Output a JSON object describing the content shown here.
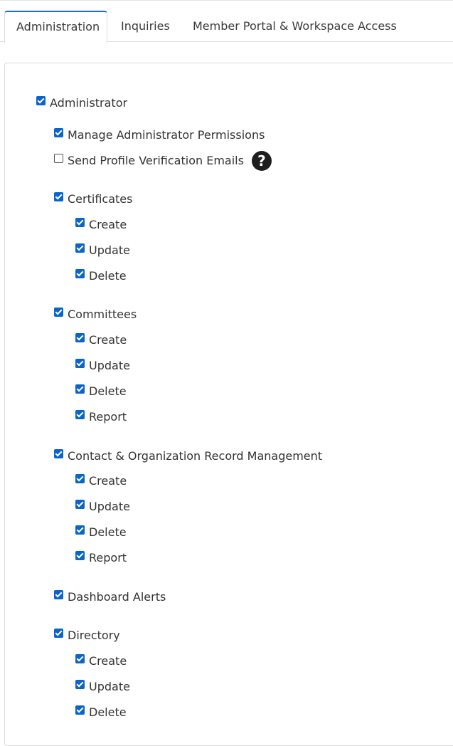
{
  "tabs": [
    {
      "label": "Administration"
    },
    {
      "label": "Inquiries"
    },
    {
      "label": "Member Portal & Workspace Access"
    }
  ],
  "permissions": [
    {
      "label": "Administrator",
      "checked": true
    },
    {
      "label": "Manage Administrator Permissions",
      "checked": true
    },
    {
      "label": "Send Profile Verification Emails",
      "checked": false,
      "help_icon": "question-circle-icon"
    },
    {
      "label": "Certificates",
      "checked": true
    },
    {
      "label": "Create",
      "checked": true
    },
    {
      "label": "Update",
      "checked": true
    },
    {
      "label": "Delete",
      "checked": true
    },
    {
      "label": "Committees",
      "checked": true
    },
    {
      "label": "Create",
      "checked": true
    },
    {
      "label": "Update",
      "checked": true
    },
    {
      "label": "Delete",
      "checked": true
    },
    {
      "label": "Report",
      "checked": true
    },
    {
      "label": "Contact & Organization Record Management",
      "checked": true
    },
    {
      "label": "Create",
      "checked": true
    },
    {
      "label": "Update",
      "checked": true
    },
    {
      "label": "Delete",
      "checked": true
    },
    {
      "label": "Report",
      "checked": true
    },
    {
      "label": "Dashboard Alerts",
      "checked": true
    },
    {
      "label": "Directory",
      "checked": true
    },
    {
      "label": "Create",
      "checked": true
    },
    {
      "label": "Update",
      "checked": true
    },
    {
      "label": "Delete",
      "checked": true
    }
  ],
  "colors": {
    "accent": "#1a73b8",
    "checkbox": "#0b64c8"
  }
}
